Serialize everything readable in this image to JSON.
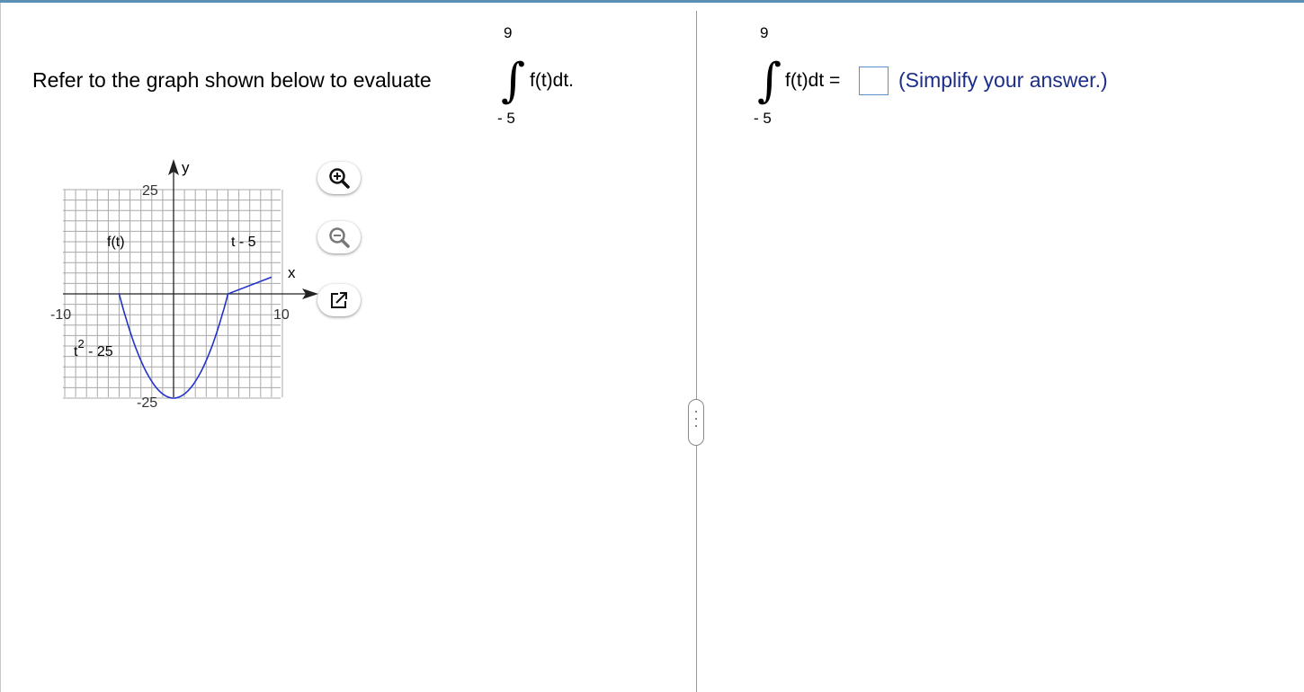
{
  "question": {
    "prompt": "Refer to the graph shown below to evaluate",
    "integral": {
      "upper": "9",
      "lower": "- 5",
      "integrand": "f(t)dt."
    }
  },
  "answer": {
    "upper": "9",
    "lower": "- 5",
    "lhs": "f(t)dt =",
    "value": "",
    "hint": "(Simplify your answer.)"
  },
  "graph": {
    "axis_x": "x",
    "axis_y": "y",
    "tick_x_min": "-10",
    "tick_x_max": "10",
    "tick_y_max": "25",
    "tick_y_min": "-25",
    "label_function": "f(t)",
    "label_right_piece": "t - 5",
    "label_left_piece_base": "t",
    "label_left_piece_exp": "2",
    "label_left_piece_rest": " - 25",
    "curve_color": "#2233cc"
  },
  "chart_data": {
    "type": "line",
    "title": "",
    "xlabel": "x",
    "ylabel": "y",
    "xlim": [
      -10,
      10
    ],
    "ylim": [
      -25,
      25
    ],
    "grid": true,
    "series": [
      {
        "x": [
          -5,
          -4,
          -3,
          -2,
          -1,
          0,
          1,
          2,
          3,
          4,
          5
        ],
        "y": [
          0,
          -9,
          -16,
          -21,
          -24,
          -25,
          -24,
          -21,
          -16,
          -9,
          0
        ]
      },
      {
        "x": [
          5,
          9
        ],
        "y": [
          0,
          4
        ]
      }
    ]
  },
  "controls": {
    "zoom_in": "zoom-in-icon",
    "zoom_out": "zoom-out-icon",
    "popout": "popout-icon"
  }
}
